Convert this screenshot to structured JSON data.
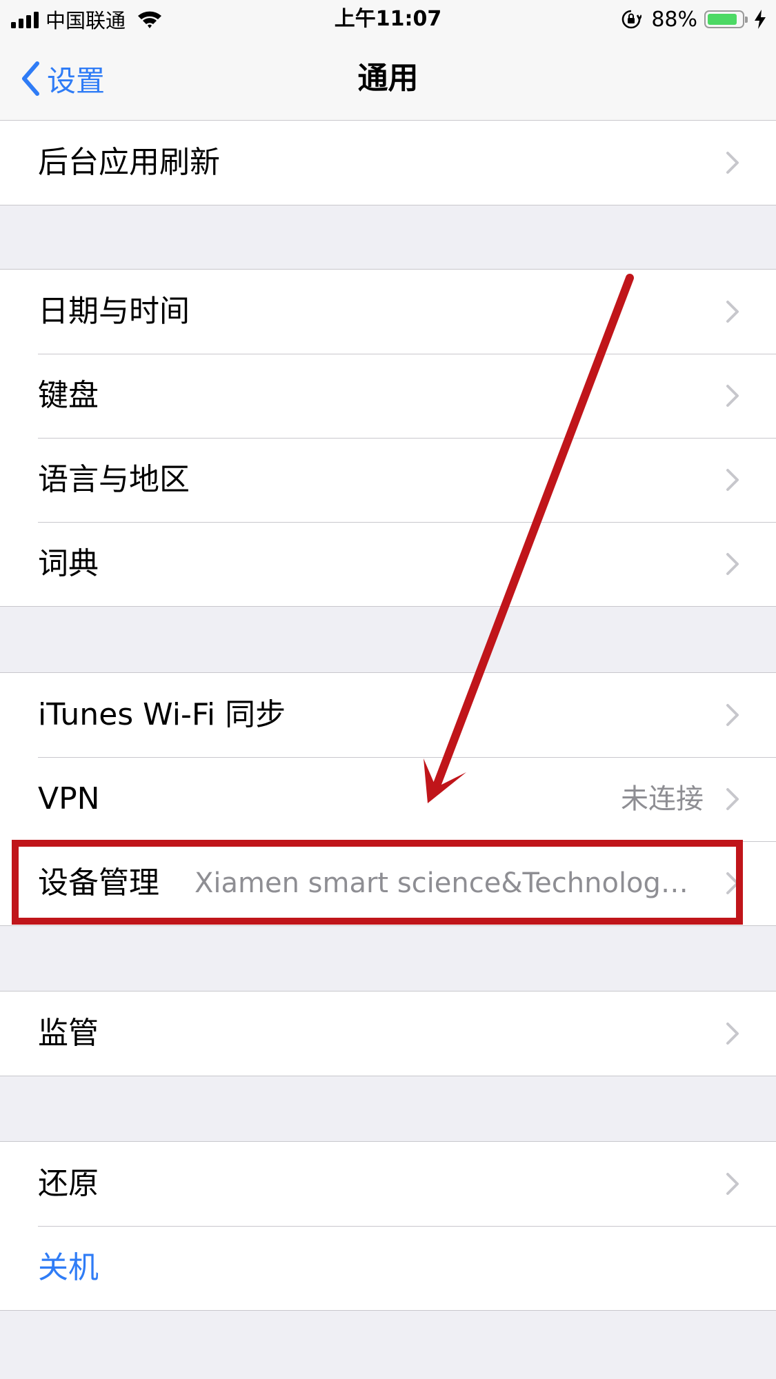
{
  "status_bar": {
    "carrier": "中国联通",
    "time": "上午11:07",
    "battery_percent": "88%",
    "battery_level": 0.88,
    "battery_color": "#4cd964",
    "icons": [
      "signal-icon",
      "wifi-icon",
      "rotation-lock-icon",
      "battery-icon",
      "charging-bolt-icon"
    ]
  },
  "nav": {
    "back_label": "设置",
    "title": "通用",
    "accent_color": "#2f7cf6"
  },
  "groups": [
    {
      "items": [
        {
          "label": "后台应用刷新",
          "value": ""
        }
      ]
    },
    {
      "items": [
        {
          "label": "日期与时间",
          "value": ""
        },
        {
          "label": "键盘",
          "value": ""
        },
        {
          "label": "语言与地区",
          "value": ""
        },
        {
          "label": "词典",
          "value": ""
        }
      ]
    },
    {
      "items": [
        {
          "label": "iTunes Wi-Fi 同步",
          "value": ""
        },
        {
          "label": "VPN",
          "value": "未连接"
        },
        {
          "label": "设备管理",
          "value": "Xiamen smart science&Technology Co.,Ltd"
        }
      ]
    },
    {
      "items": [
        {
          "label": "监管",
          "value": ""
        }
      ]
    },
    {
      "items": [
        {
          "label": "还原",
          "value": ""
        },
        {
          "label": "关机",
          "value": ""
        }
      ]
    }
  ],
  "annotation": {
    "highlight_color": "#c0151a",
    "highlighted_item": "设备管理"
  }
}
